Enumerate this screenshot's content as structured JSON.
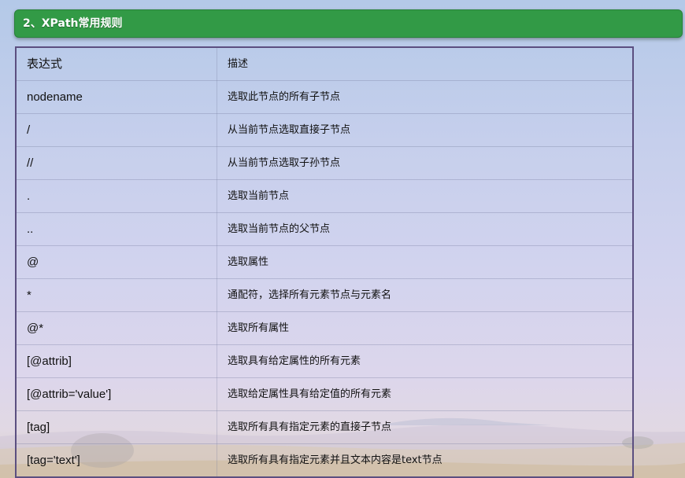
{
  "section": {
    "title": "2、XPath常用规则"
  },
  "table": {
    "headers": [
      "表达式",
      "描述"
    ],
    "rows": [
      [
        "nodename",
        "选取此节点的所有子节点"
      ],
      [
        "/",
        "从当前节点选取直接子节点"
      ],
      [
        "//",
        "从当前节点选取子孙节点"
      ],
      [
        ".",
        "选取当前节点"
      ],
      [
        "..",
        "选取当前节点的父节点"
      ],
      [
        "@",
        "选取属性"
      ],
      [
        "*",
        "通配符，选择所有元素节点与元素名"
      ],
      [
        "@*",
        "选取所有属性"
      ],
      [
        "[@attrib]",
        "选取具有给定属性的所有元素"
      ],
      [
        "[@attrib='value']",
        "选取给定属性具有给定值的所有元素"
      ],
      [
        "[tag]",
        "选取所有具有指定元素的直接子节点"
      ],
      [
        "[tag='text']",
        "选取所有具有指定元素并且文本内容是text节点"
      ]
    ]
  },
  "colors": {
    "header_bg": "#329a46",
    "table_border": "#5b4f80"
  }
}
